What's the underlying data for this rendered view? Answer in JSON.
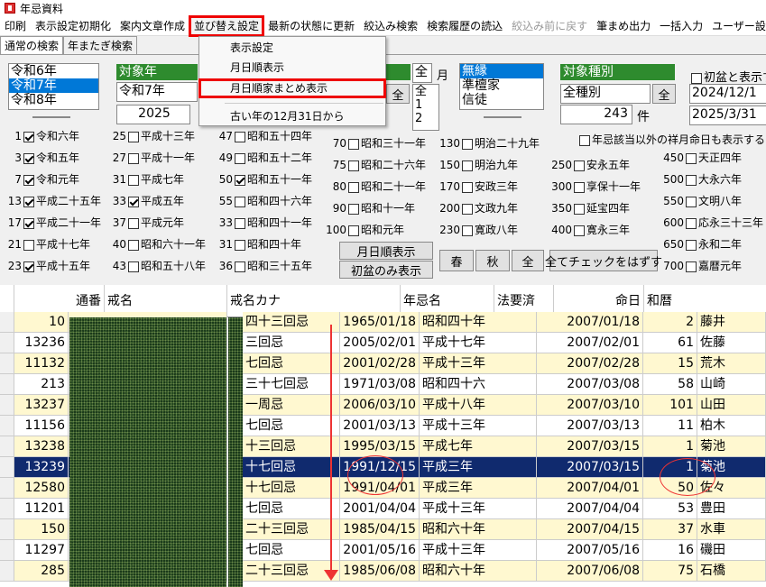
{
  "window": {
    "title": "年忌資料"
  },
  "menu": [
    "印刷",
    "表示設定初期化",
    "案内文章作成",
    "並び替え設定",
    "最新の状態に更新",
    "絞込み検索",
    "検索履歴の読込",
    "絞込み前に戻す",
    "筆まめ出力",
    "一括入力",
    "ユーザー設"
  ],
  "dropdown": [
    "表示設定",
    "月日順表示",
    "月日順家まとめ表示",
    "古い年の12月31日から"
  ],
  "tabs": [
    "通常の検索",
    "年またぎ検索"
  ],
  "year_list": [
    "令和6年",
    "令和7年",
    "令和8年"
  ],
  "target_year": {
    "header": "対象年",
    "value": "令和7年",
    "year": "2025"
  },
  "month": {
    "value": "全",
    "label": "月",
    "options": [
      "全",
      "1",
      "2"
    ],
    "btn": "全"
  },
  "category_list": [
    "無縁",
    "準檀家",
    "信徒"
  ],
  "target_type": {
    "header": "対象種別",
    "value": "全種別",
    "btn": "全",
    "count": "243",
    "unit": "件"
  },
  "first_bon": {
    "label": "初盆と表示す",
    "from": "2024/12/1",
    "to": "2025/3/31"
  },
  "other_month_label": "年忌該当以外の祥月命日も表示する",
  "col1": [
    {
      "n": "1",
      "on": true,
      "t": "令和六年"
    },
    {
      "n": "3",
      "on": true,
      "t": "令和五年"
    },
    {
      "n": "7",
      "on": true,
      "t": "令和元年"
    },
    {
      "n": "13",
      "on": true,
      "t": "平成二十五年"
    },
    {
      "n": "17",
      "on": true,
      "t": "平成二十一年"
    },
    {
      "n": "21",
      "on": false,
      "t": "平成十七年"
    },
    {
      "n": "23",
      "on": true,
      "t": "平成十五年"
    }
  ],
  "col2": [
    {
      "n": "25",
      "on": false,
      "t": "平成十三年"
    },
    {
      "n": "27",
      "on": false,
      "t": "平成十一年"
    },
    {
      "n": "31",
      "on": false,
      "t": "平成七年"
    },
    {
      "n": "33",
      "on": true,
      "t": "平成五年"
    },
    {
      "n": "37",
      "on": false,
      "t": "平成元年"
    },
    {
      "n": "40",
      "on": false,
      "t": "昭和六十一年"
    },
    {
      "n": "43",
      "on": false,
      "t": "昭和五十八年"
    }
  ],
  "col3": [
    {
      "n": "47",
      "on": false,
      "t": "昭和五十四年"
    },
    {
      "n": "49",
      "on": false,
      "t": "昭和五十二年"
    },
    {
      "n": "50",
      "on": true,
      "t": "昭和五十一年"
    },
    {
      "n": "55",
      "on": false,
      "t": "昭和四十六年"
    },
    {
      "n": "33",
      "on": false,
      "t": "昭和四十一年"
    },
    {
      "n": "31",
      "on": false,
      "t": "昭和四十年"
    },
    {
      "n": "36",
      "on": false,
      "t": "昭和三十五年"
    }
  ],
  "col4": [
    {
      "n": "70",
      "on": false,
      "t": "昭和三十一年"
    },
    {
      "n": "75",
      "on": false,
      "t": "昭和二十六年"
    },
    {
      "n": "80",
      "on": false,
      "t": "昭和二十一年"
    },
    {
      "n": "90",
      "on": false,
      "t": "昭和十一年"
    },
    {
      "n": "100",
      "on": false,
      "t": "昭和元年"
    }
  ],
  "col5": [
    {
      "n": "130",
      "on": false,
      "t": "明治二十九年"
    },
    {
      "n": "150",
      "on": false,
      "t": "明治九年"
    },
    {
      "n": "170",
      "on": false,
      "t": "安政三年"
    },
    {
      "n": "200",
      "on": false,
      "t": "文政九年"
    },
    {
      "n": "230",
      "on": false,
      "t": "寛政八年"
    }
  ],
  "col6": [
    {
      "n": "250",
      "on": false,
      "t": "安永五年"
    },
    {
      "n": "300",
      "on": false,
      "t": "享保十一年"
    },
    {
      "n": "350",
      "on": false,
      "t": "延宝四年"
    },
    {
      "n": "400",
      "on": false,
      "t": "寛永三年"
    }
  ],
  "col7": [
    {
      "n": "450",
      "on": false,
      "t": "天正四年"
    },
    {
      "n": "500",
      "on": false,
      "t": "大永六年"
    },
    {
      "n": "550",
      "on": false,
      "t": "文明八年"
    },
    {
      "n": "600",
      "on": false,
      "t": "応永三十三年"
    },
    {
      "n": "650",
      "on": false,
      "t": "永和二年"
    },
    {
      "n": "700",
      "on": false,
      "t": "嘉暦元年"
    }
  ],
  "buttons": {
    "month_order": "月日順表示",
    "first_bon_only": "初盆のみ表示",
    "spring": "春",
    "autumn": "秋",
    "all": "全",
    "uncheck_all": "全てチェックをはずす"
  },
  "grid_headers": [
    "通番",
    "戒名",
    "戒名カナ",
    "年忌名",
    "法要済",
    "命日",
    "和暦"
  ],
  "rows": [
    {
      "no": "10",
      "nenki": "四十三回忌",
      "death": "1965/01/18",
      "era": "昭和四十年",
      "date": "2007/01/18",
      "age": "2",
      "name": "藤井"
    },
    {
      "no": "13236",
      "nenki": "三回忌",
      "death": "2005/02/01",
      "era": "平成十七年",
      "date": "2007/02/01",
      "age": "61",
      "name": "佐藤"
    },
    {
      "no": "11132",
      "nenki": "七回忌",
      "death": "2001/02/28",
      "era": "平成十三年",
      "date": "2007/02/28",
      "age": "15",
      "name": "荒木"
    },
    {
      "no": "213",
      "nenki": "三十七回忌",
      "death": "1971/03/08",
      "era": "昭和四十六",
      "date": "2007/03/08",
      "age": "58",
      "name": "山崎"
    },
    {
      "no": "13237",
      "nenki": "一周忌",
      "death": "2006/03/10",
      "era": "平成十八年",
      "date": "2007/03/10",
      "age": "101",
      "name": "山田"
    },
    {
      "no": "11156",
      "nenki": "七回忌",
      "death": "2001/03/13",
      "era": "平成十三年",
      "date": "2007/03/13",
      "age": "11",
      "name": "柏木"
    },
    {
      "no": "13238",
      "nenki": "十三回忌",
      "death": "1995/03/15",
      "era": "平成七年",
      "date": "2007/03/15",
      "age": "1",
      "name": "菊池"
    },
    {
      "no": "13239",
      "nenki": "十七回忌",
      "death": "1991/12/15",
      "era": "平成三年",
      "date": "2007/03/15",
      "age": "1",
      "name": "菊池"
    },
    {
      "no": "12580",
      "nenki": "十七回忌",
      "death": "1991/04/01",
      "era": "平成三年",
      "date": "2007/04/01",
      "age": "50",
      "name": "佐々"
    },
    {
      "no": "11201",
      "nenki": "七回忌",
      "death": "2001/04/04",
      "era": "平成十三年",
      "date": "2007/04/04",
      "age": "53",
      "name": "豊田"
    },
    {
      "no": "150",
      "nenki": "二十三回忌",
      "death": "1985/04/15",
      "era": "昭和六十年",
      "date": "2007/04/15",
      "age": "37",
      "name": "水車"
    },
    {
      "no": "11297",
      "nenki": "七回忌",
      "death": "2001/05/16",
      "era": "平成十三年",
      "date": "2007/05/16",
      "age": "16",
      "name": "磯田"
    },
    {
      "no": "285",
      "nenki": "二十三回忌",
      "death": "1985/06/08",
      "era": "昭和六十年",
      "date": "2007/06/08",
      "age": "75",
      "name": "石橋"
    }
  ]
}
